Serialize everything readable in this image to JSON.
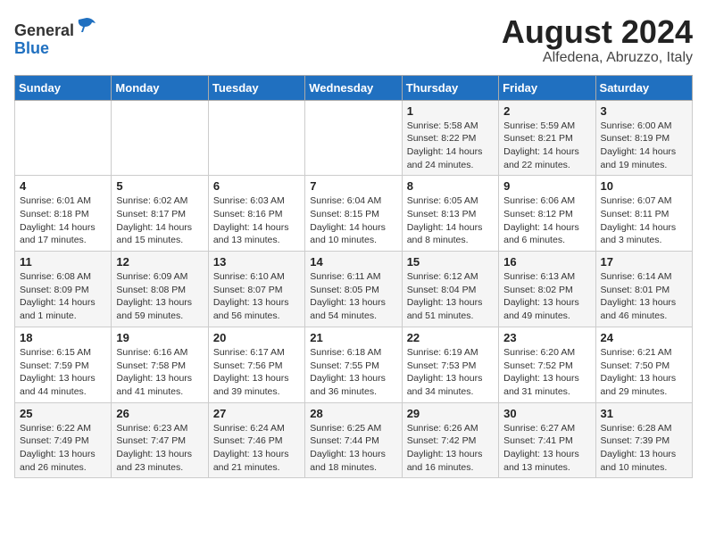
{
  "header": {
    "logo_line1": "General",
    "logo_line2": "Blue",
    "month_year": "August 2024",
    "location": "Alfedena, Abruzzo, Italy"
  },
  "days_of_week": [
    "Sunday",
    "Monday",
    "Tuesday",
    "Wednesday",
    "Thursday",
    "Friday",
    "Saturday"
  ],
  "weeks": [
    [
      {
        "day": "",
        "info": ""
      },
      {
        "day": "",
        "info": ""
      },
      {
        "day": "",
        "info": ""
      },
      {
        "day": "",
        "info": ""
      },
      {
        "day": "1",
        "info": "Sunrise: 5:58 AM\nSunset: 8:22 PM\nDaylight: 14 hours and 24 minutes."
      },
      {
        "day": "2",
        "info": "Sunrise: 5:59 AM\nSunset: 8:21 PM\nDaylight: 14 hours and 22 minutes."
      },
      {
        "day": "3",
        "info": "Sunrise: 6:00 AM\nSunset: 8:19 PM\nDaylight: 14 hours and 19 minutes."
      }
    ],
    [
      {
        "day": "4",
        "info": "Sunrise: 6:01 AM\nSunset: 8:18 PM\nDaylight: 14 hours and 17 minutes."
      },
      {
        "day": "5",
        "info": "Sunrise: 6:02 AM\nSunset: 8:17 PM\nDaylight: 14 hours and 15 minutes."
      },
      {
        "day": "6",
        "info": "Sunrise: 6:03 AM\nSunset: 8:16 PM\nDaylight: 14 hours and 13 minutes."
      },
      {
        "day": "7",
        "info": "Sunrise: 6:04 AM\nSunset: 8:15 PM\nDaylight: 14 hours and 10 minutes."
      },
      {
        "day": "8",
        "info": "Sunrise: 6:05 AM\nSunset: 8:13 PM\nDaylight: 14 hours and 8 minutes."
      },
      {
        "day": "9",
        "info": "Sunrise: 6:06 AM\nSunset: 8:12 PM\nDaylight: 14 hours and 6 minutes."
      },
      {
        "day": "10",
        "info": "Sunrise: 6:07 AM\nSunset: 8:11 PM\nDaylight: 14 hours and 3 minutes."
      }
    ],
    [
      {
        "day": "11",
        "info": "Sunrise: 6:08 AM\nSunset: 8:09 PM\nDaylight: 14 hours and 1 minute."
      },
      {
        "day": "12",
        "info": "Sunrise: 6:09 AM\nSunset: 8:08 PM\nDaylight: 13 hours and 59 minutes."
      },
      {
        "day": "13",
        "info": "Sunrise: 6:10 AM\nSunset: 8:07 PM\nDaylight: 13 hours and 56 minutes."
      },
      {
        "day": "14",
        "info": "Sunrise: 6:11 AM\nSunset: 8:05 PM\nDaylight: 13 hours and 54 minutes."
      },
      {
        "day": "15",
        "info": "Sunrise: 6:12 AM\nSunset: 8:04 PM\nDaylight: 13 hours and 51 minutes."
      },
      {
        "day": "16",
        "info": "Sunrise: 6:13 AM\nSunset: 8:02 PM\nDaylight: 13 hours and 49 minutes."
      },
      {
        "day": "17",
        "info": "Sunrise: 6:14 AM\nSunset: 8:01 PM\nDaylight: 13 hours and 46 minutes."
      }
    ],
    [
      {
        "day": "18",
        "info": "Sunrise: 6:15 AM\nSunset: 7:59 PM\nDaylight: 13 hours and 44 minutes."
      },
      {
        "day": "19",
        "info": "Sunrise: 6:16 AM\nSunset: 7:58 PM\nDaylight: 13 hours and 41 minutes."
      },
      {
        "day": "20",
        "info": "Sunrise: 6:17 AM\nSunset: 7:56 PM\nDaylight: 13 hours and 39 minutes."
      },
      {
        "day": "21",
        "info": "Sunrise: 6:18 AM\nSunset: 7:55 PM\nDaylight: 13 hours and 36 minutes."
      },
      {
        "day": "22",
        "info": "Sunrise: 6:19 AM\nSunset: 7:53 PM\nDaylight: 13 hours and 34 minutes."
      },
      {
        "day": "23",
        "info": "Sunrise: 6:20 AM\nSunset: 7:52 PM\nDaylight: 13 hours and 31 minutes."
      },
      {
        "day": "24",
        "info": "Sunrise: 6:21 AM\nSunset: 7:50 PM\nDaylight: 13 hours and 29 minutes."
      }
    ],
    [
      {
        "day": "25",
        "info": "Sunrise: 6:22 AM\nSunset: 7:49 PM\nDaylight: 13 hours and 26 minutes."
      },
      {
        "day": "26",
        "info": "Sunrise: 6:23 AM\nSunset: 7:47 PM\nDaylight: 13 hours and 23 minutes."
      },
      {
        "day": "27",
        "info": "Sunrise: 6:24 AM\nSunset: 7:46 PM\nDaylight: 13 hours and 21 minutes."
      },
      {
        "day": "28",
        "info": "Sunrise: 6:25 AM\nSunset: 7:44 PM\nDaylight: 13 hours and 18 minutes."
      },
      {
        "day": "29",
        "info": "Sunrise: 6:26 AM\nSunset: 7:42 PM\nDaylight: 13 hours and 16 minutes."
      },
      {
        "day": "30",
        "info": "Sunrise: 6:27 AM\nSunset: 7:41 PM\nDaylight: 13 hours and 13 minutes."
      },
      {
        "day": "31",
        "info": "Sunrise: 6:28 AM\nSunset: 7:39 PM\nDaylight: 13 hours and 10 minutes."
      }
    ]
  ]
}
